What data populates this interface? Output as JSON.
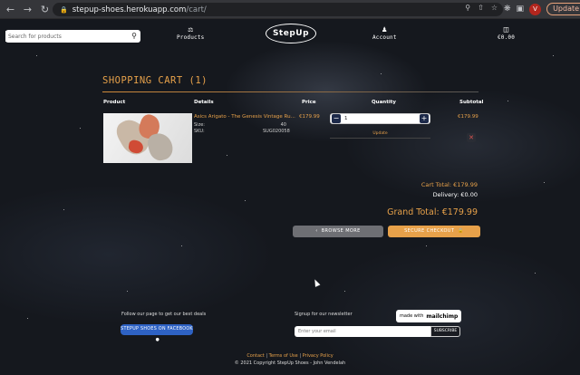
{
  "browser": {
    "url_host": "stepup-shoes.herokuapp.com",
    "url_path": "/cart/",
    "avatar_letter": "V",
    "update_label": "Update"
  },
  "header": {
    "search_placeholder": "Search for products",
    "nav_left": "Products",
    "logo": "StepUp",
    "nav_right_1": "Account",
    "nav_right_2": "€0.00"
  },
  "cart": {
    "title": "SHOPPING CART (1)",
    "columns": [
      "Product",
      "Details",
      "Price",
      "Quantity",
      "Subtotal"
    ],
    "item": {
      "name": "Asics Arigato - The Genesis Vintage Ru...",
      "size_label": "Size:",
      "size_value": "40",
      "sku_label": "SKU:",
      "sku_value": "SUG020058",
      "price": "€179.99",
      "quantity": "1",
      "update_label": "Update",
      "subtotal": "€179.99"
    },
    "cart_total": "Cart Total: €179.99",
    "delivery": "Delivery: €0.00",
    "grand_total": "Grand Total: €179.99",
    "browse_more": "BROWSE MORE",
    "secure_checkout": "SECURE CHECKOUT"
  },
  "footer": {
    "follow_text": "Follow our page to get our best deals",
    "facebook_btn": "STEPUP SHOES ON FACEBOOK",
    "signup_text": "Signup for our newsletter",
    "mailchimp_prefix": "made with",
    "mailchimp_logo": "mailchimp",
    "email_placeholder": "Enter your email",
    "subscribe_btn": "SUBSCRIBE",
    "link_contact": "Contact",
    "link_terms": "Terms of Use",
    "link_privacy": "Privacy Policy",
    "copyright": "© 2021 Copyright StepUp Shoes - John Vendelah"
  },
  "colors": {
    "accent": "#e7a14a",
    "facebook": "#2e62c4",
    "page_bg": "#15181e"
  }
}
